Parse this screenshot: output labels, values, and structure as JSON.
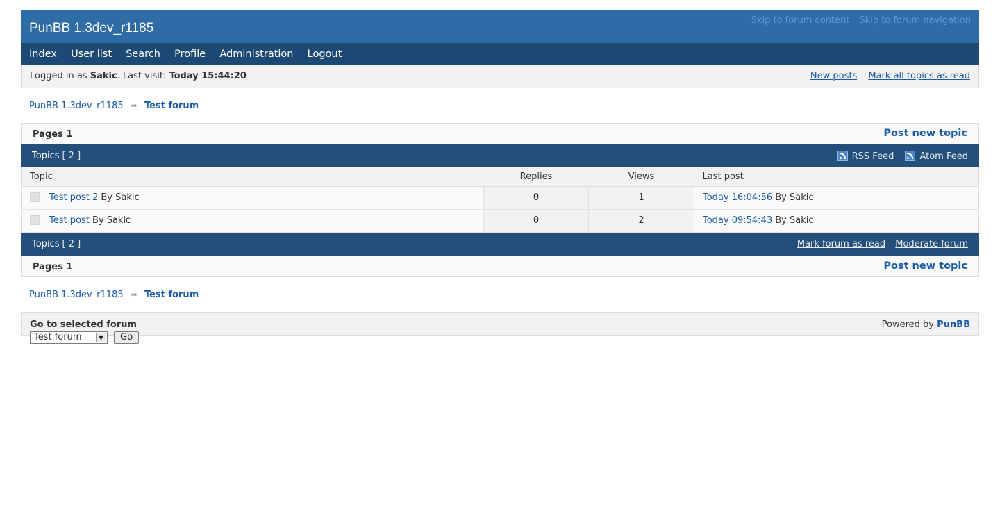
{
  "header": {
    "title": "PunBB 1.3dev_r1185",
    "skip_content": "Skip to forum content",
    "skip_navigation": "Skip to forum navigation"
  },
  "nav": {
    "items": [
      "Index",
      "User list",
      "Search",
      "Profile",
      "Administration",
      "Logout"
    ]
  },
  "status": {
    "logged_in_prefix": "Logged in as ",
    "username": "Sakic",
    "last_visit_prefix": ". Last visit: ",
    "last_visit": "Today 15:44:20",
    "new_posts": "New posts",
    "mark_all_read": "Mark all topics as read"
  },
  "breadcrumb": {
    "root": "PunBB 1.3dev_r1185",
    "arrow": "➡",
    "current": "Test forum"
  },
  "pagebar": {
    "pages": "Pages 1",
    "post_new_topic": "Post new topic"
  },
  "topics_head": {
    "label": "Topics",
    "count": "[ 2 ]",
    "rss": "RSS Feed",
    "atom": "Atom Feed",
    "mark_forum_read": "Mark forum as read",
    "moderate_forum": "Moderate forum"
  },
  "table": {
    "headers": {
      "topic": "Topic",
      "replies": "Replies",
      "views": "Views",
      "last_post": "Last post"
    },
    "rows": [
      {
        "title": "Test post 2",
        "by": "By Sakic",
        "replies": "0",
        "views": "1",
        "last_post_time": "Today 16:04:56",
        "last_post_by": "By Sakic"
      },
      {
        "title": "Test post",
        "by": "By Sakic",
        "replies": "0",
        "views": "2",
        "last_post_time": "Today 09:54:43",
        "last_post_by": "By Sakic"
      }
    ]
  },
  "jump": {
    "label": "Go to selected forum",
    "selected": "Test forum",
    "go": "Go",
    "powered_prefix": "Powered by ",
    "powered_link": "PunBB"
  },
  "icons": {
    "feed": "rss-icon",
    "topic_status": "topic-status-icon",
    "dropdown": "chevron-down-icon"
  }
}
